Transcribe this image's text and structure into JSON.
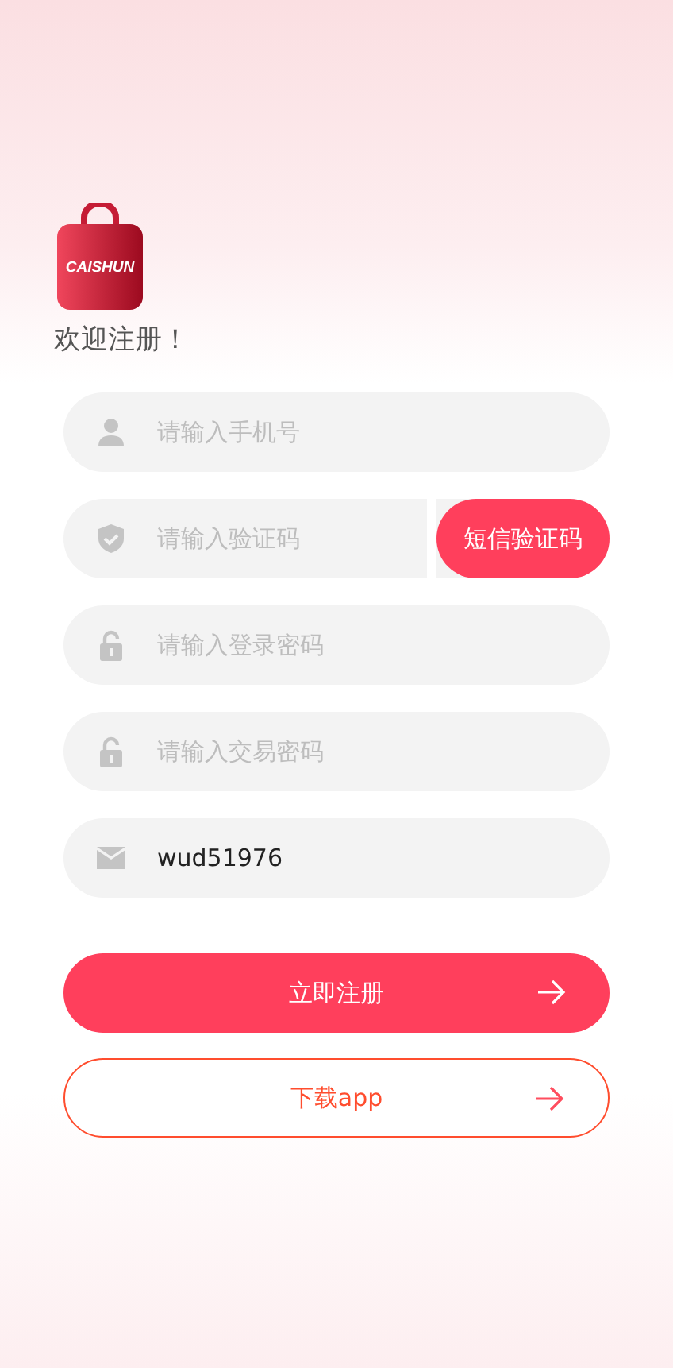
{
  "logo": {
    "text": "CAISHUN"
  },
  "welcome": "欢迎注册！",
  "fields": [
    {
      "kind": "phone",
      "placeholder": "请输入手机号"
    },
    {
      "kind": "code",
      "placeholder": "请输入验证码",
      "button": "短信验证码"
    },
    {
      "kind": "password",
      "placeholder": "请输入登录密码"
    },
    {
      "kind": "password",
      "placeholder": "请输入交易密码"
    },
    {
      "kind": "invite",
      "value": "wud51976"
    }
  ],
  "buttons": [
    {
      "kind": "primary",
      "label": "立即注册"
    },
    {
      "kind": "outline",
      "label": "下载app"
    }
  ]
}
